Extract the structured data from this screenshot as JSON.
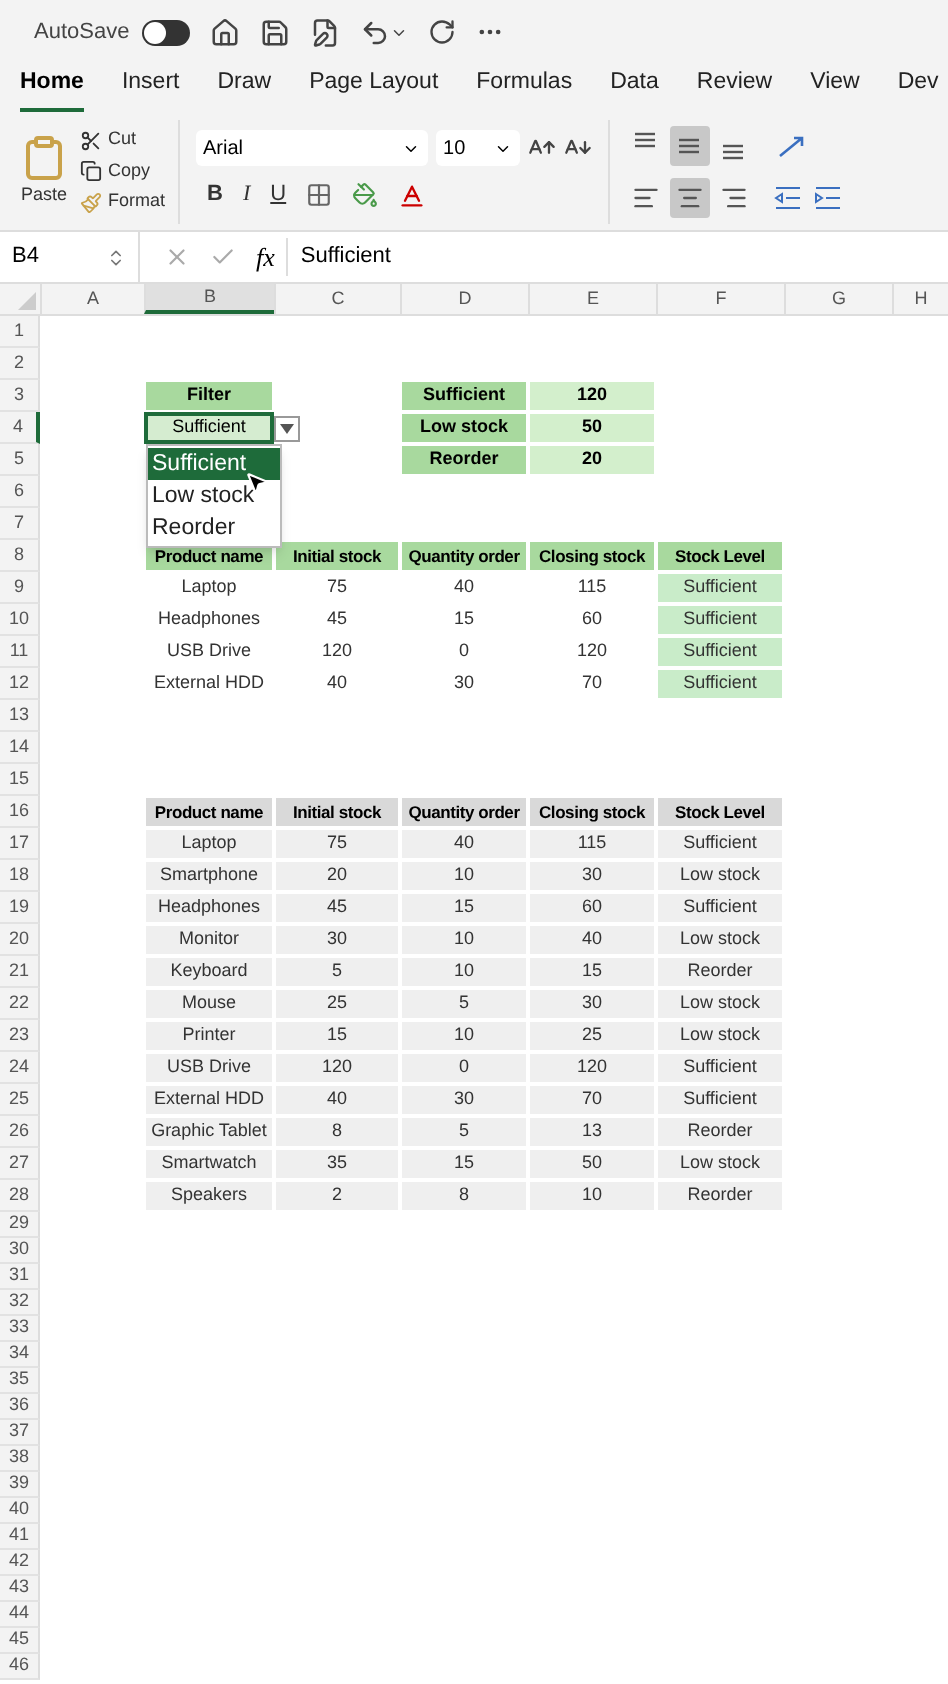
{
  "quick_access": {
    "autosave_label": "AutoSave",
    "autosave_on": false
  },
  "tabs": [
    {
      "label": "Home",
      "selected": true
    },
    {
      "label": "Insert",
      "selected": false
    },
    {
      "label": "Draw",
      "selected": false
    },
    {
      "label": "Page Layout",
      "selected": false
    },
    {
      "label": "Formulas",
      "selected": false
    },
    {
      "label": "Data",
      "selected": false
    },
    {
      "label": "Review",
      "selected": false
    },
    {
      "label": "View",
      "selected": false
    },
    {
      "label": "Dev",
      "selected": false
    }
  ],
  "ribbon": {
    "clipboard": {
      "paste": "Paste",
      "cut": "Cut",
      "copy": "Copy",
      "format": "Format"
    },
    "font": {
      "name": "Arial",
      "size": "10",
      "bold": "B",
      "italic": "I",
      "underline": "U"
    },
    "vertical_align": [
      {
        "kind": "top",
        "selected": false
      },
      {
        "kind": "middle",
        "selected": true
      },
      {
        "kind": "bottom",
        "selected": false
      }
    ],
    "horizontal_align": [
      {
        "kind": "left",
        "selected": false
      },
      {
        "kind": "center",
        "selected": true
      },
      {
        "kind": "right",
        "selected": false
      }
    ]
  },
  "formula_bar": {
    "name_box": "B4",
    "fx": "fx",
    "value": "Sufficient"
  },
  "column_headers": [
    {
      "label": "A",
      "selected": false
    },
    {
      "label": "B",
      "selected": true
    },
    {
      "label": "C",
      "selected": false
    },
    {
      "label": "D",
      "selected": false
    },
    {
      "label": "E",
      "selected": false
    },
    {
      "label": "F",
      "selected": false
    },
    {
      "label": "G",
      "selected": false
    },
    {
      "label": "H",
      "selected": false
    }
  ],
  "row_numbers": [
    {
      "label": "1",
      "selected": false
    },
    {
      "label": "2",
      "selected": false
    },
    {
      "label": "3",
      "selected": false
    },
    {
      "label": "4",
      "selected": true
    },
    {
      "label": "5",
      "selected": false
    },
    {
      "label": "6",
      "selected": false
    },
    {
      "label": "7",
      "selected": false
    },
    {
      "label": "8",
      "selected": false
    },
    {
      "label": "9",
      "selected": false
    },
    {
      "label": "10",
      "selected": false
    },
    {
      "label": "11",
      "selected": false
    },
    {
      "label": "12",
      "selected": false
    },
    {
      "label": "13",
      "selected": false
    },
    {
      "label": "14",
      "selected": false
    },
    {
      "label": "15",
      "selected": false
    },
    {
      "label": "16",
      "selected": false
    },
    {
      "label": "17",
      "selected": false
    },
    {
      "label": "18",
      "selected": false
    },
    {
      "label": "19",
      "selected": false
    },
    {
      "label": "20",
      "selected": false
    },
    {
      "label": "21",
      "selected": false
    },
    {
      "label": "22",
      "selected": false
    },
    {
      "label": "23",
      "selected": false
    },
    {
      "label": "24",
      "selected": false
    },
    {
      "label": "25",
      "selected": false
    },
    {
      "label": "26",
      "selected": false
    },
    {
      "label": "27",
      "selected": false
    },
    {
      "label": "28",
      "selected": false
    },
    {
      "label": "29",
      "selected": false
    },
    {
      "label": "30",
      "selected": false
    },
    {
      "label": "31",
      "selected": false
    },
    {
      "label": "32",
      "selected": false
    },
    {
      "label": "33",
      "selected": false
    },
    {
      "label": "34",
      "selected": false
    },
    {
      "label": "35",
      "selected": false
    },
    {
      "label": "36",
      "selected": false
    },
    {
      "label": "37",
      "selected": false
    },
    {
      "label": "38",
      "selected": false
    },
    {
      "label": "39",
      "selected": false
    },
    {
      "label": "40",
      "selected": false
    },
    {
      "label": "41",
      "selected": false
    },
    {
      "label": "42",
      "selected": false
    },
    {
      "label": "43",
      "selected": false
    },
    {
      "label": "44",
      "selected": false
    },
    {
      "label": "45",
      "selected": false
    },
    {
      "label": "46",
      "selected": false
    }
  ],
  "filter": {
    "label": "Filter",
    "value": "Sufficient",
    "options": [
      {
        "label": "Sufficient",
        "selected": true
      },
      {
        "label": "Low stock",
        "selected": false
      },
      {
        "label": "Reorder",
        "selected": false
      }
    ]
  },
  "summary": [
    {
      "label": "Sufficient",
      "value": "120"
    },
    {
      "label": "Low stock",
      "value": "50"
    },
    {
      "label": "Reorder",
      "value": "20"
    }
  ],
  "filtered_table": {
    "columns": [
      "Product name",
      "Initial stock",
      "Quantity order",
      "Closing stock",
      "Stock Level"
    ],
    "rows": [
      [
        "Laptop",
        "75",
        "40",
        "115",
        "Sufficient"
      ],
      [
        "Headphones",
        "45",
        "15",
        "60",
        "Sufficient"
      ],
      [
        "USB Drive",
        "120",
        "0",
        "120",
        "Sufficient"
      ],
      [
        "External HDD",
        "40",
        "30",
        "70",
        "Sufficient"
      ]
    ]
  },
  "inventory_table": {
    "columns": [
      "Product name",
      "Initial stock",
      "Quantity order",
      "Closing stock",
      "Stock Level"
    ],
    "rows": [
      [
        "Laptop",
        "75",
        "40",
        "115",
        "Sufficient"
      ],
      [
        "Smartphone",
        "20",
        "10",
        "30",
        "Low stock"
      ],
      [
        "Headphones",
        "45",
        "15",
        "60",
        "Sufficient"
      ],
      [
        "Monitor",
        "30",
        "10",
        "40",
        "Low stock"
      ],
      [
        "Keyboard",
        "5",
        "10",
        "15",
        "Reorder"
      ],
      [
        "Mouse",
        "25",
        "5",
        "30",
        "Low stock"
      ],
      [
        "Printer",
        "15",
        "10",
        "25",
        "Low stock"
      ],
      [
        "USB Drive",
        "120",
        "0",
        "120",
        "Sufficient"
      ],
      [
        "External HDD",
        "40",
        "30",
        "70",
        "Sufficient"
      ],
      [
        "Graphic Tablet",
        "8",
        "5",
        "13",
        "Reorder"
      ],
      [
        "Smartwatch",
        "35",
        "15",
        "50",
        "Low stock"
      ],
      [
        "Speakers",
        "2",
        "8",
        "10",
        "Reorder"
      ]
    ]
  }
}
